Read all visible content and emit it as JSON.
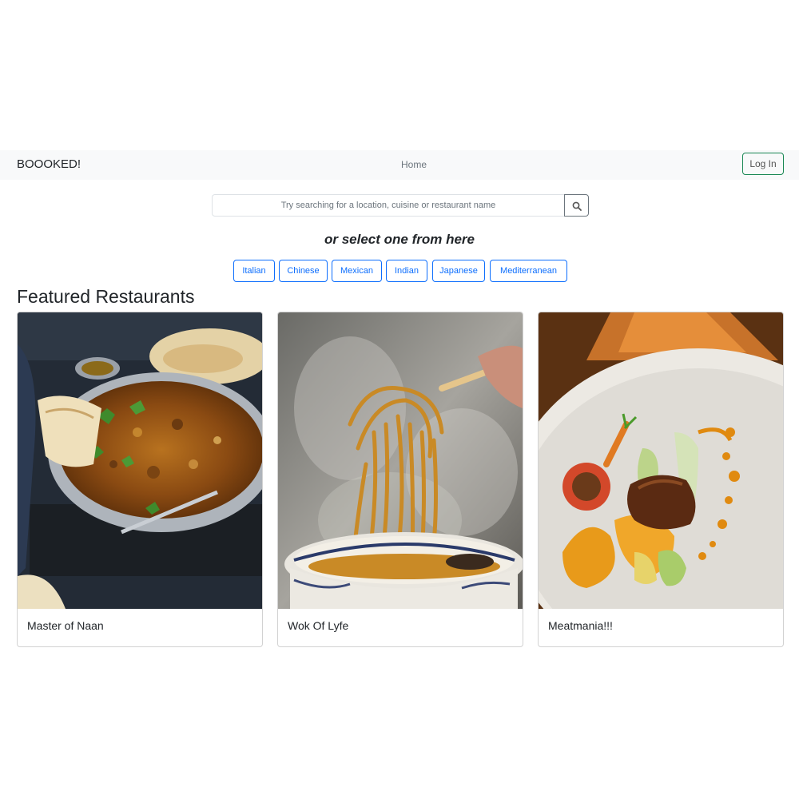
{
  "nav": {
    "brand": "BOOOKED!",
    "home": "Home",
    "login": "Log In"
  },
  "search": {
    "placeholder": "Try searching for a location, cuisine or restaurant name",
    "button_icon": "search-icon"
  },
  "select_heading": "or select one from here",
  "cuisines": [
    "Italian",
    "Chinese",
    "Mexican",
    "Indian",
    "Japanese",
    "Mediterranean"
  ],
  "featured": {
    "title": "Featured Restaurants",
    "restaurants": [
      {
        "name": "Master of Naan",
        "image": "curry-dish-photo"
      },
      {
        "name": "Wok Of Lyfe",
        "image": "noodles-photo"
      },
      {
        "name": "Meatmania!!!",
        "image": "plated-steak-photo"
      }
    ]
  },
  "colors": {
    "navbar_bg": "#f8f9fa",
    "login_border": "#198754",
    "cuisine_accent": "#0d6efd"
  }
}
